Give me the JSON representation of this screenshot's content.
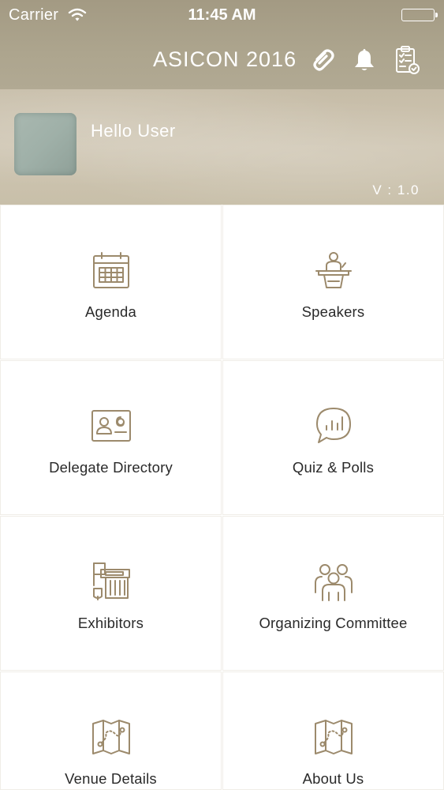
{
  "status_bar": {
    "carrier": "Carrier",
    "time": "11:45 AM",
    "wifi_icon": "wifi-icon",
    "battery_icon": "battery-icon"
  },
  "header": {
    "title": "ASICON 2016",
    "icons": [
      "attachment-icon",
      "bell-icon",
      "survey-clipboard-icon"
    ]
  },
  "profile": {
    "greeting": "Hello User",
    "version": "V : 1.0"
  },
  "menu": {
    "items": [
      {
        "label": "Agenda",
        "icon": "calendar-icon"
      },
      {
        "label": "Speakers",
        "icon": "speaker-podium-icon"
      },
      {
        "label": "Delegate Directory",
        "icon": "contact-card-icon"
      },
      {
        "label": "Quiz & Polls",
        "icon": "poll-chat-icon"
      },
      {
        "label": "Exhibitors",
        "icon": "exhibitor-booth-icon"
      },
      {
        "label": "Organizing Committee",
        "icon": "group-icon"
      },
      {
        "label": "Venue Details",
        "icon": "map-icon"
      },
      {
        "label": "About Us",
        "icon": "map-icon"
      }
    ]
  },
  "colors": {
    "header_bg": "#ada58e",
    "profile_bg": "#cbc2ae",
    "icon_stroke": "#9c8a6c",
    "label_text": "#2a2a2a"
  }
}
